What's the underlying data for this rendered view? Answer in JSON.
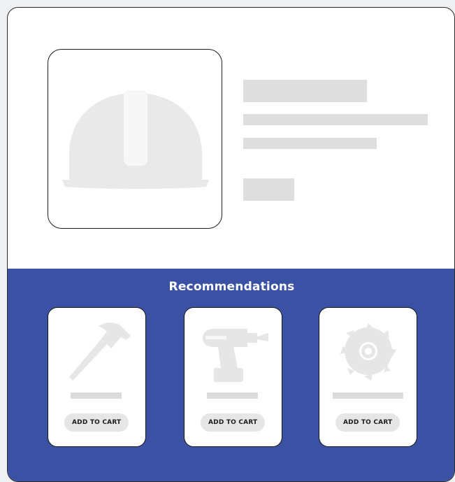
{
  "product": {
    "image_icon": "hard-hat-icon",
    "image_color": "#e9e9e9",
    "skeleton_color": "#dedede"
  },
  "recommendations": {
    "title": "Recommendations",
    "background": "#3b52a4",
    "items": [
      {
        "icon": "hammer-icon",
        "button_label": "ADD TO CART"
      },
      {
        "icon": "drill-icon",
        "button_label": "ADD TO CART"
      },
      {
        "icon": "saw-blade-icon",
        "button_label": "ADD TO CART"
      }
    ]
  }
}
